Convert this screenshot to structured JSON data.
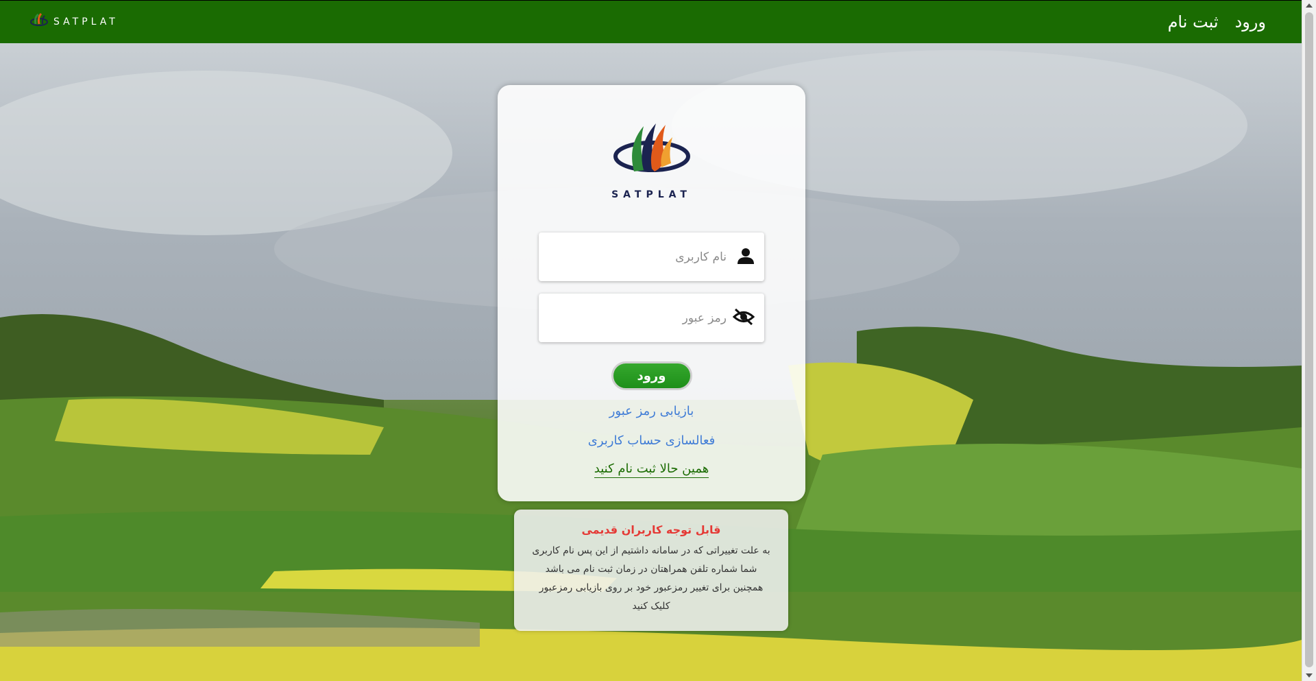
{
  "navbar": {
    "brand": "SATPLAT",
    "links": [
      "ورود",
      "ثبت نام"
    ],
    "background": "#1a6b02"
  },
  "login": {
    "brand": "SATPLAT",
    "username_placeholder": "نام کاربری",
    "password_placeholder": "رمز عبور",
    "submit_label": "ورود",
    "recover_link": "بازیابی رمز عبور",
    "activate_link": "فعالسازی حساب کاربری",
    "register_link": "همین حالا ثبت نام کنید",
    "icons": [
      "user-icon",
      "eye-slash-icon"
    ]
  },
  "notice": {
    "title": "قابل توجه کاربران قدیمی",
    "body": "به علت تغییراتی که در سامانه داشتیم از این پس نام کاربری شما شماره تلفن همراهتان در زمان ثبت نام می باشد همچنین برای تغییر رمزعبور خود بر روی بازیابی رمزعبور کلیک کنید"
  },
  "colors": {
    "accent_green": "#1a6b02",
    "button_green": "#2a9c22",
    "link_blue": "#3e7bd6",
    "notice_red": "#e53935"
  }
}
